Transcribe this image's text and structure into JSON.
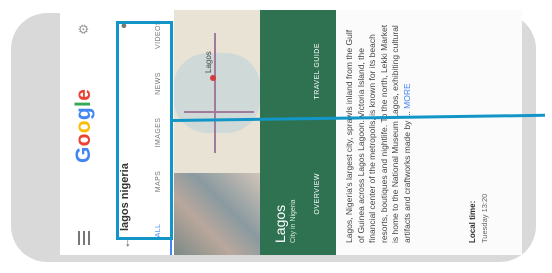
{
  "app": {
    "logo": "Google"
  },
  "search": {
    "query": "lagos nigeria"
  },
  "tabs": [
    "ALL",
    "MAPS",
    "IMAGES",
    "NEWS",
    "VIDEOS"
  ],
  "map": {
    "label": "Lagos"
  },
  "place": {
    "name": "Lagos",
    "subtitle": "City in Nigeria",
    "actions": [
      "OVERVIEW",
      "TRAVEL GUIDE"
    ]
  },
  "description": {
    "text": "Lagos, Nigeria's largest city, sprawls inland from the Gulf of Guinea across Lagos Lagoon. Victoria Island, the financial center of the metropolis, is known for its beach resorts, boutiques and nightlife. To the north, Lekki Market is home to the National Museum Lagos, exhibiting cultural artifacts and craftworks made by ...",
    "more": "MORE"
  },
  "local_time": {
    "label": "Local time:",
    "value": "Tuesday 13:20"
  },
  "colors": {
    "highlight": "#1296c8",
    "card": "#2e7252",
    "frame": "#d9d9da"
  }
}
